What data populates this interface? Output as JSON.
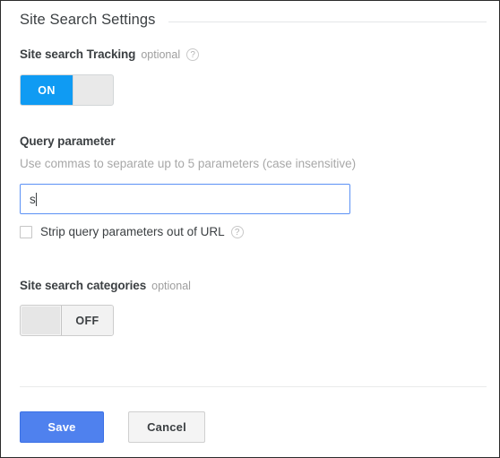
{
  "panel": {
    "section_title": "Site Search Settings"
  },
  "tracking": {
    "label": "Site search Tracking",
    "optional": "optional",
    "help_icon": "help-circle-icon",
    "toggle_state": "ON"
  },
  "query_parameter": {
    "label": "Query parameter",
    "description": "Use commas to separate up to 5 parameters (case insensitive)",
    "input_value": "s",
    "input_placeholder": "",
    "strip_checkbox_label": "Strip query parameters out of URL",
    "strip_checkbox_checked": "false",
    "help_icon": "help-circle-icon"
  },
  "categories": {
    "label": "Site search categories",
    "optional": "optional",
    "toggle_state": "OFF"
  },
  "footer": {
    "save_label": "Save",
    "cancel_label": "Cancel"
  },
  "colors": {
    "toggle_on_blue": "#0f9bf3",
    "primary_button_blue": "#4f81ee",
    "input_focus_border": "#5b91f5",
    "text_dark": "#3c4043",
    "text_muted": "#a8a8a8"
  }
}
